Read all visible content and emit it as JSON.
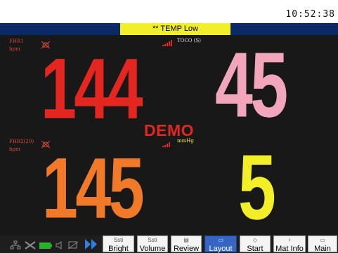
{
  "clock": "10:52:38",
  "alarm_message": "** TEMP Low",
  "fhr1": {
    "label": "FHR1",
    "unit": "bpm",
    "value": "144",
    "color": "#e3261f"
  },
  "toco": {
    "label": "TOCO (S)",
    "value": "45",
    "color": "#f2a6bc"
  },
  "watermark": "DEMO",
  "fhr2": {
    "label": "FHR2(20)",
    "unit": "bpm",
    "value": "145",
    "color": "#f07a2a"
  },
  "pressure": {
    "unit": "mmHg",
    "value": "5",
    "color": "#f2ee28"
  },
  "buttons": [
    {
      "icon": "bright-icon",
      "icon_text": "Ssti",
      "label": "Bright"
    },
    {
      "icon": "volume-icon",
      "icon_text": "Ssti",
      "label": "Volume"
    },
    {
      "icon": "review-icon",
      "icon_text": "▤",
      "label": "Review"
    },
    {
      "icon": "layout-icon",
      "icon_text": "▭",
      "label": "Layout"
    },
    {
      "icon": "start-icon",
      "icon_text": "◇",
      "label": "Start"
    },
    {
      "icon": "mat-info-icon",
      "icon_text": "♀",
      "label": "Mat Info"
    },
    {
      "icon": "main-icon",
      "icon_text": "▭",
      "label": "Main"
    }
  ],
  "status_icons": [
    "network-icon",
    "cable-disconnected-icon",
    "battery-icon",
    "speaker-icon",
    "card-icon"
  ],
  "colors": {
    "fhr1": "#e3261f",
    "toco": "#f2a6bc",
    "fhr2": "#f07a2a",
    "pressure": "#f2ee28",
    "active_button": "#3566c4"
  }
}
